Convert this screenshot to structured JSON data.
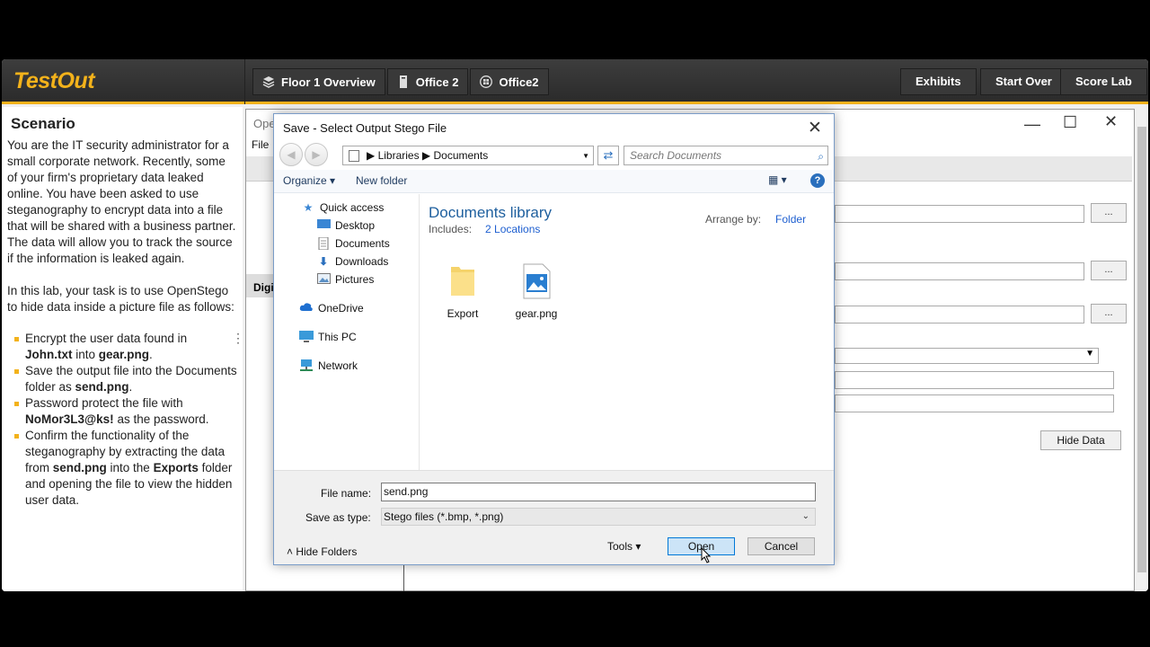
{
  "app": {
    "logo": "TestOut",
    "breadcrumbs": [
      {
        "label": "Floor 1 Overview",
        "icon": "layers-icon"
      },
      {
        "label": "Office 2",
        "icon": "tower-icon"
      },
      {
        "label": "Office2",
        "icon": "windows-icon"
      }
    ],
    "buttons": {
      "exhibits": "Exhibits",
      "start_over": "Start Over",
      "score_lab": "Score Lab"
    }
  },
  "scenario": {
    "title": "Scenario",
    "intro": "You are the IT security administrator for a small corporate network. Recently, some of your firm's proprietary data leaked online. You have been asked to use steganography to encrypt data into a file that will be shared with a business partner. The data will allow you to track the source if the information is leaked again.",
    "task": "In this lab, your task is to use OpenStego to hide data inside a picture file as follows:",
    "bullets": [
      {
        "a": "Encrypt the user data found in ",
        "b1": "John.txt",
        "c": " into ",
        "b2": "gear.png",
        "d": "."
      },
      {
        "a": "Save the output file into the Documents folder as ",
        "b1": "send.png",
        "c": ".",
        "b2": "",
        "d": ""
      },
      {
        "a": "Password protect the file with ",
        "b1": "NoMor3L3@ks!",
        "c": " as the password.",
        "b2": "",
        "d": ""
      },
      {
        "a": "Confirm the functionality of the steganography by extracting the data from ",
        "b1": "send.png",
        "c": " into the ",
        "b2": "Exports",
        "d": " folder and opening the file to view the hidden user data."
      }
    ]
  },
  "bg_window": {
    "title_partial": "Ope",
    "menu_file": "File",
    "section_partial": "Digi",
    "browse": "...",
    "hide_data": "Hide Data"
  },
  "dialog": {
    "title": "Save - Select Output Stego File",
    "address": {
      "root": "Libraries",
      "current": "Documents"
    },
    "search_placeholder": "Search Documents",
    "organize": "Organize",
    "new_folder": "New folder",
    "nav": {
      "quick_access": "Quick access",
      "desktop": "Desktop",
      "documents": "Documents",
      "downloads": "Downloads",
      "pictures": "Pictures",
      "onedrive": "OneDrive",
      "this_pc": "This PC",
      "network": "Network"
    },
    "library_title": "Documents library",
    "includes_label": "Includes:",
    "includes_link": "2 Locations",
    "arrange_label": "Arrange by:",
    "arrange_value": "Folder",
    "files": [
      {
        "name": "Export",
        "icon": "folder-icon"
      },
      {
        "name": "gear.png",
        "icon": "image-file-icon"
      }
    ],
    "file_name_label": "File name:",
    "file_name_value": "send.png",
    "save_type_label": "Save as type:",
    "save_type_value": "Stego files (*.bmp, *.png)",
    "hide_folders": "Hide Folders",
    "tools": "Tools",
    "open": "Open",
    "cancel": "Cancel"
  },
  "colors": {
    "accent": "#f3b21b",
    "link": "#1e5fd0",
    "library_title": "#1e5f9e"
  }
}
